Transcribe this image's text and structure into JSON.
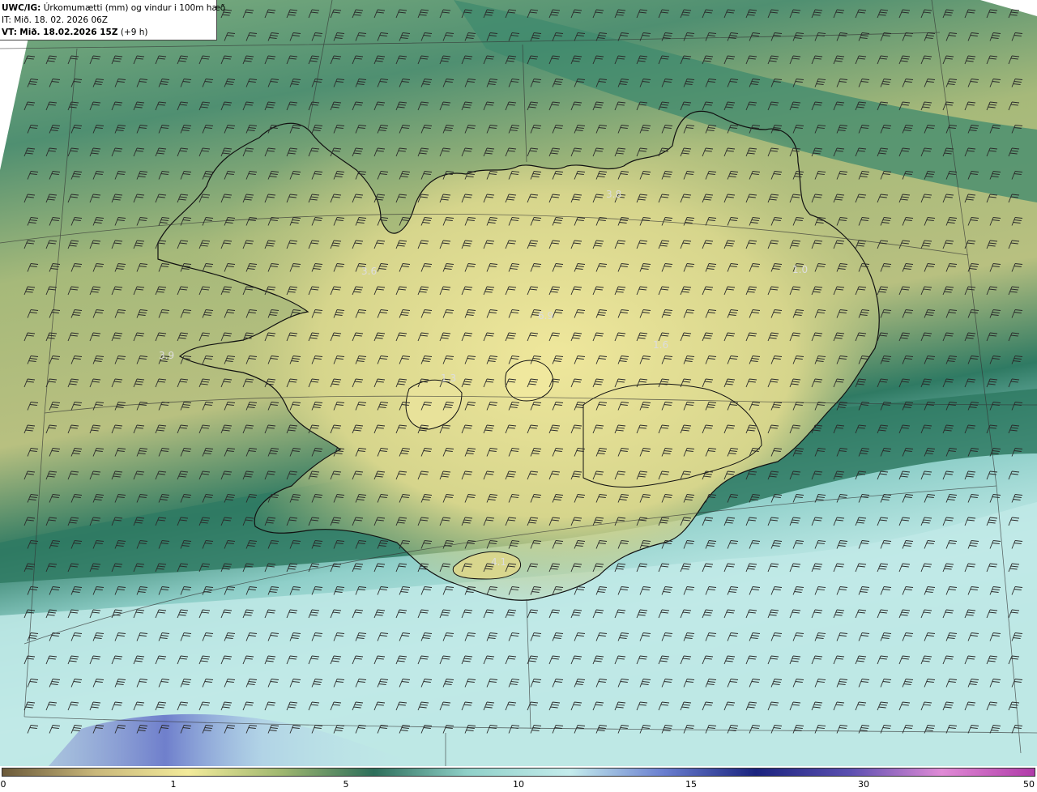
{
  "header": {
    "product": "UWC/IG:",
    "description": "Úrkomumætti (mm) og vindur i 100m hæð",
    "issue_time": "IT: Mið. 18. 02. 2026 06Z",
    "valid_prefix": "VT:",
    "valid_time": "Mið. 18.02.2026 15Z",
    "valid_offset": "(+9 h)"
  },
  "colorbar": {
    "ticks": [
      {
        "value": "0"
      },
      {
        "value": "1"
      },
      {
        "value": "5"
      },
      {
        "value": "10"
      },
      {
        "value": "15"
      },
      {
        "value": "30"
      },
      {
        "value": "50"
      }
    ],
    "colors": [
      "#6b5a3a",
      "#c9b77a",
      "#f3eb9a",
      "#9fb76f",
      "#2d6e5a",
      "#8fd0c8",
      "#c4ecec",
      "#6a7fd0",
      "#1a237e",
      "#5a4fb0",
      "#e08bd6",
      "#b03ba8"
    ]
  },
  "map": {
    "value_labels": [
      "3.8",
      "3.6",
      "3.9",
      "4.1",
      "1.3",
      "6.9",
      "1.6",
      "1.0"
    ],
    "colors": {
      "land_yellow": "#e9e295",
      "olive": "#a7b97a",
      "green_dark": "#2f7a63",
      "teal_light": "#9ad6d2",
      "cyan_pale": "#c7eeec",
      "blue_band": "#7484cf",
      "coast": "#111111",
      "barb": "#2a2a2a"
    }
  }
}
